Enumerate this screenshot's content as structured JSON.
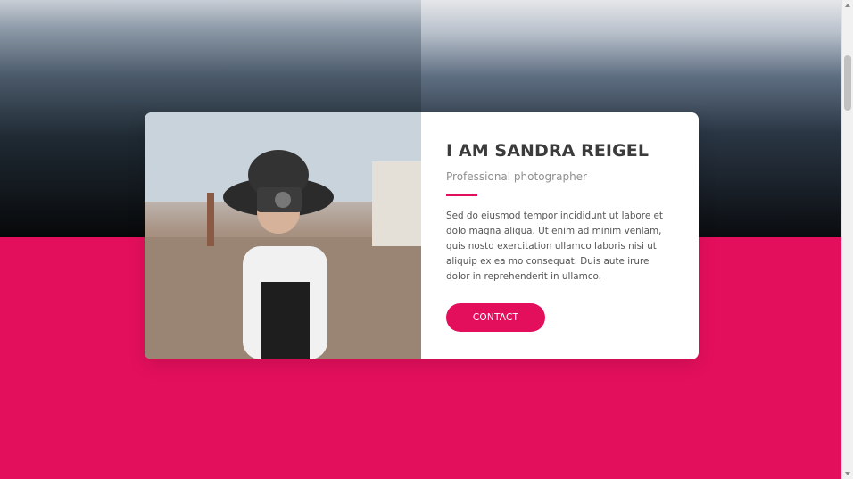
{
  "profile": {
    "name": "I AM SANDRA REIGEL",
    "role": "Professional photographer",
    "bio": "Sed do eiusmod tempor incididunt ut labore et dolo magna aliqua. Ut enim ad minim venlam, quis nostd exercitation ullamco laboris nisi ut aliquip ex ea mo consequat. Duis aute irure dolor in reprehenderit in ullamco.",
    "cta_label": "CONTACT"
  },
  "colors": {
    "accent": "#e40f5c",
    "card_bg": "#ffffff",
    "title": "#3b3b3b"
  }
}
